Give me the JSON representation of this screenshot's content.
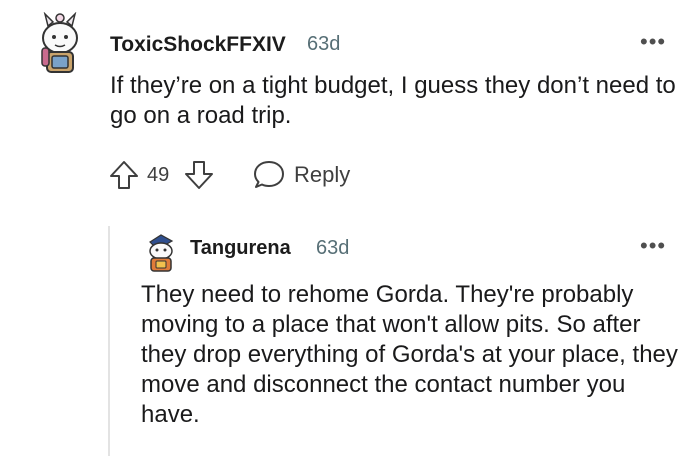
{
  "comment": {
    "username": "ToxicShockFFXIV",
    "time": "63d",
    "more": "•••",
    "body": "If they’re on a tight budget, I guess they don’t need to go on a road trip.",
    "score": "49",
    "reply_label": "Reply"
  },
  "reply": {
    "username": "Tangurena",
    "time": "63d",
    "more": "•••",
    "body": "They need to rehome Gorda. They're probably moving to a place that won't allow pits. So after they drop everything of Gorda's at your place, they move and disconnect the contact number you have."
  },
  "icons": {
    "avatar1": "snoo-avatar-icon",
    "avatar2": "snoo-avatar-icon",
    "upvote": "upvote-arrow-icon",
    "downvote": "downvote-arrow-icon",
    "reply": "speech-bubble-icon"
  },
  "colors": {
    "meta_gray": "#576f76",
    "text": "#1a1a1b",
    "thread_line": "#e3e3e3"
  }
}
